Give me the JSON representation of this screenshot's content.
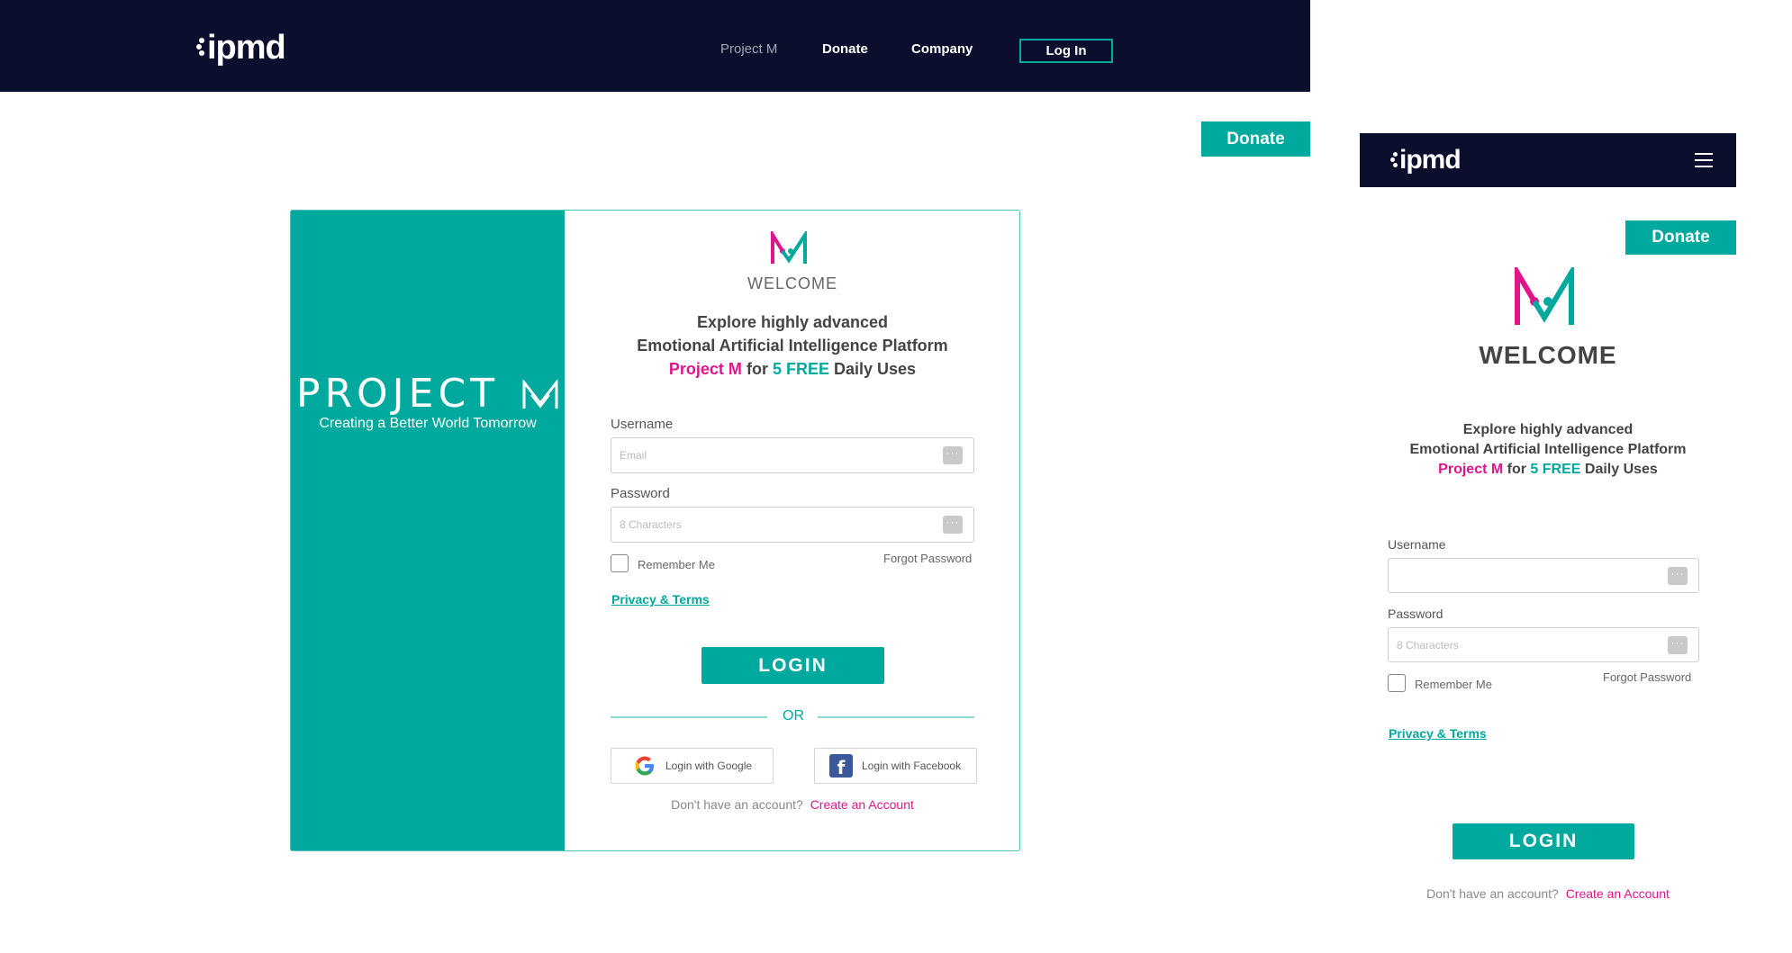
{
  "header": {
    "logo": "ipmd",
    "nav": [
      "Project M",
      "Donate",
      "Company"
    ],
    "login_label": "Log In"
  },
  "donate_label": "Donate",
  "brand": {
    "title": "PROJECT",
    "subtitle": "Creating a Better World Tomorrow"
  },
  "form": {
    "welcome": "WELCOME",
    "tagline_line1": "Explore highly advanced",
    "tagline_line2": "Emotional Artificial Intelligence Platform",
    "tagline_project": "Project M",
    "tagline_for": "for",
    "tagline_free": "5 FREE",
    "tagline_end": "Daily Uses",
    "username_label": "Username",
    "username_placeholder": "Email",
    "password_label": "Password",
    "password_placeholder": "8 Characters",
    "password_icon": "···",
    "remember_label": "Remember Me",
    "forgot_label": "Forgot Password",
    "privacy_label": "Privacy & Terms",
    "login_label": "LOGIN",
    "or_label": "OR",
    "google_label": "Login with Google",
    "facebook_label": "Login with Facebook",
    "no_account_text": "Don't have an account?",
    "create_account_label": "Create an Account"
  },
  "mobile": {
    "logo": "ipmd",
    "donate_label": "Donate",
    "welcome": "WELCOME",
    "tagline_line1": "Explore highly advanced",
    "tagline_line2": "Emotional Artificial Intelligence Platform",
    "tagline_project": "Project M",
    "tagline_for": "for",
    "tagline_free": "5 FREE",
    "tagline_end": "Daily Uses",
    "username_label": "Username",
    "password_label": "Password",
    "password_placeholder": "8 Characters",
    "password_icon": "···",
    "remember_label": "Remember Me",
    "forgot_label": "Forgot Password",
    "privacy_label": "Privacy & Terms",
    "login_label": "LOGIN",
    "no_account_text": "Don't have an account?",
    "create_account_label": "Create an Account"
  },
  "colors": {
    "navy": "#0b0e2c",
    "teal": "#00a99d",
    "pink": "#e0158c"
  }
}
